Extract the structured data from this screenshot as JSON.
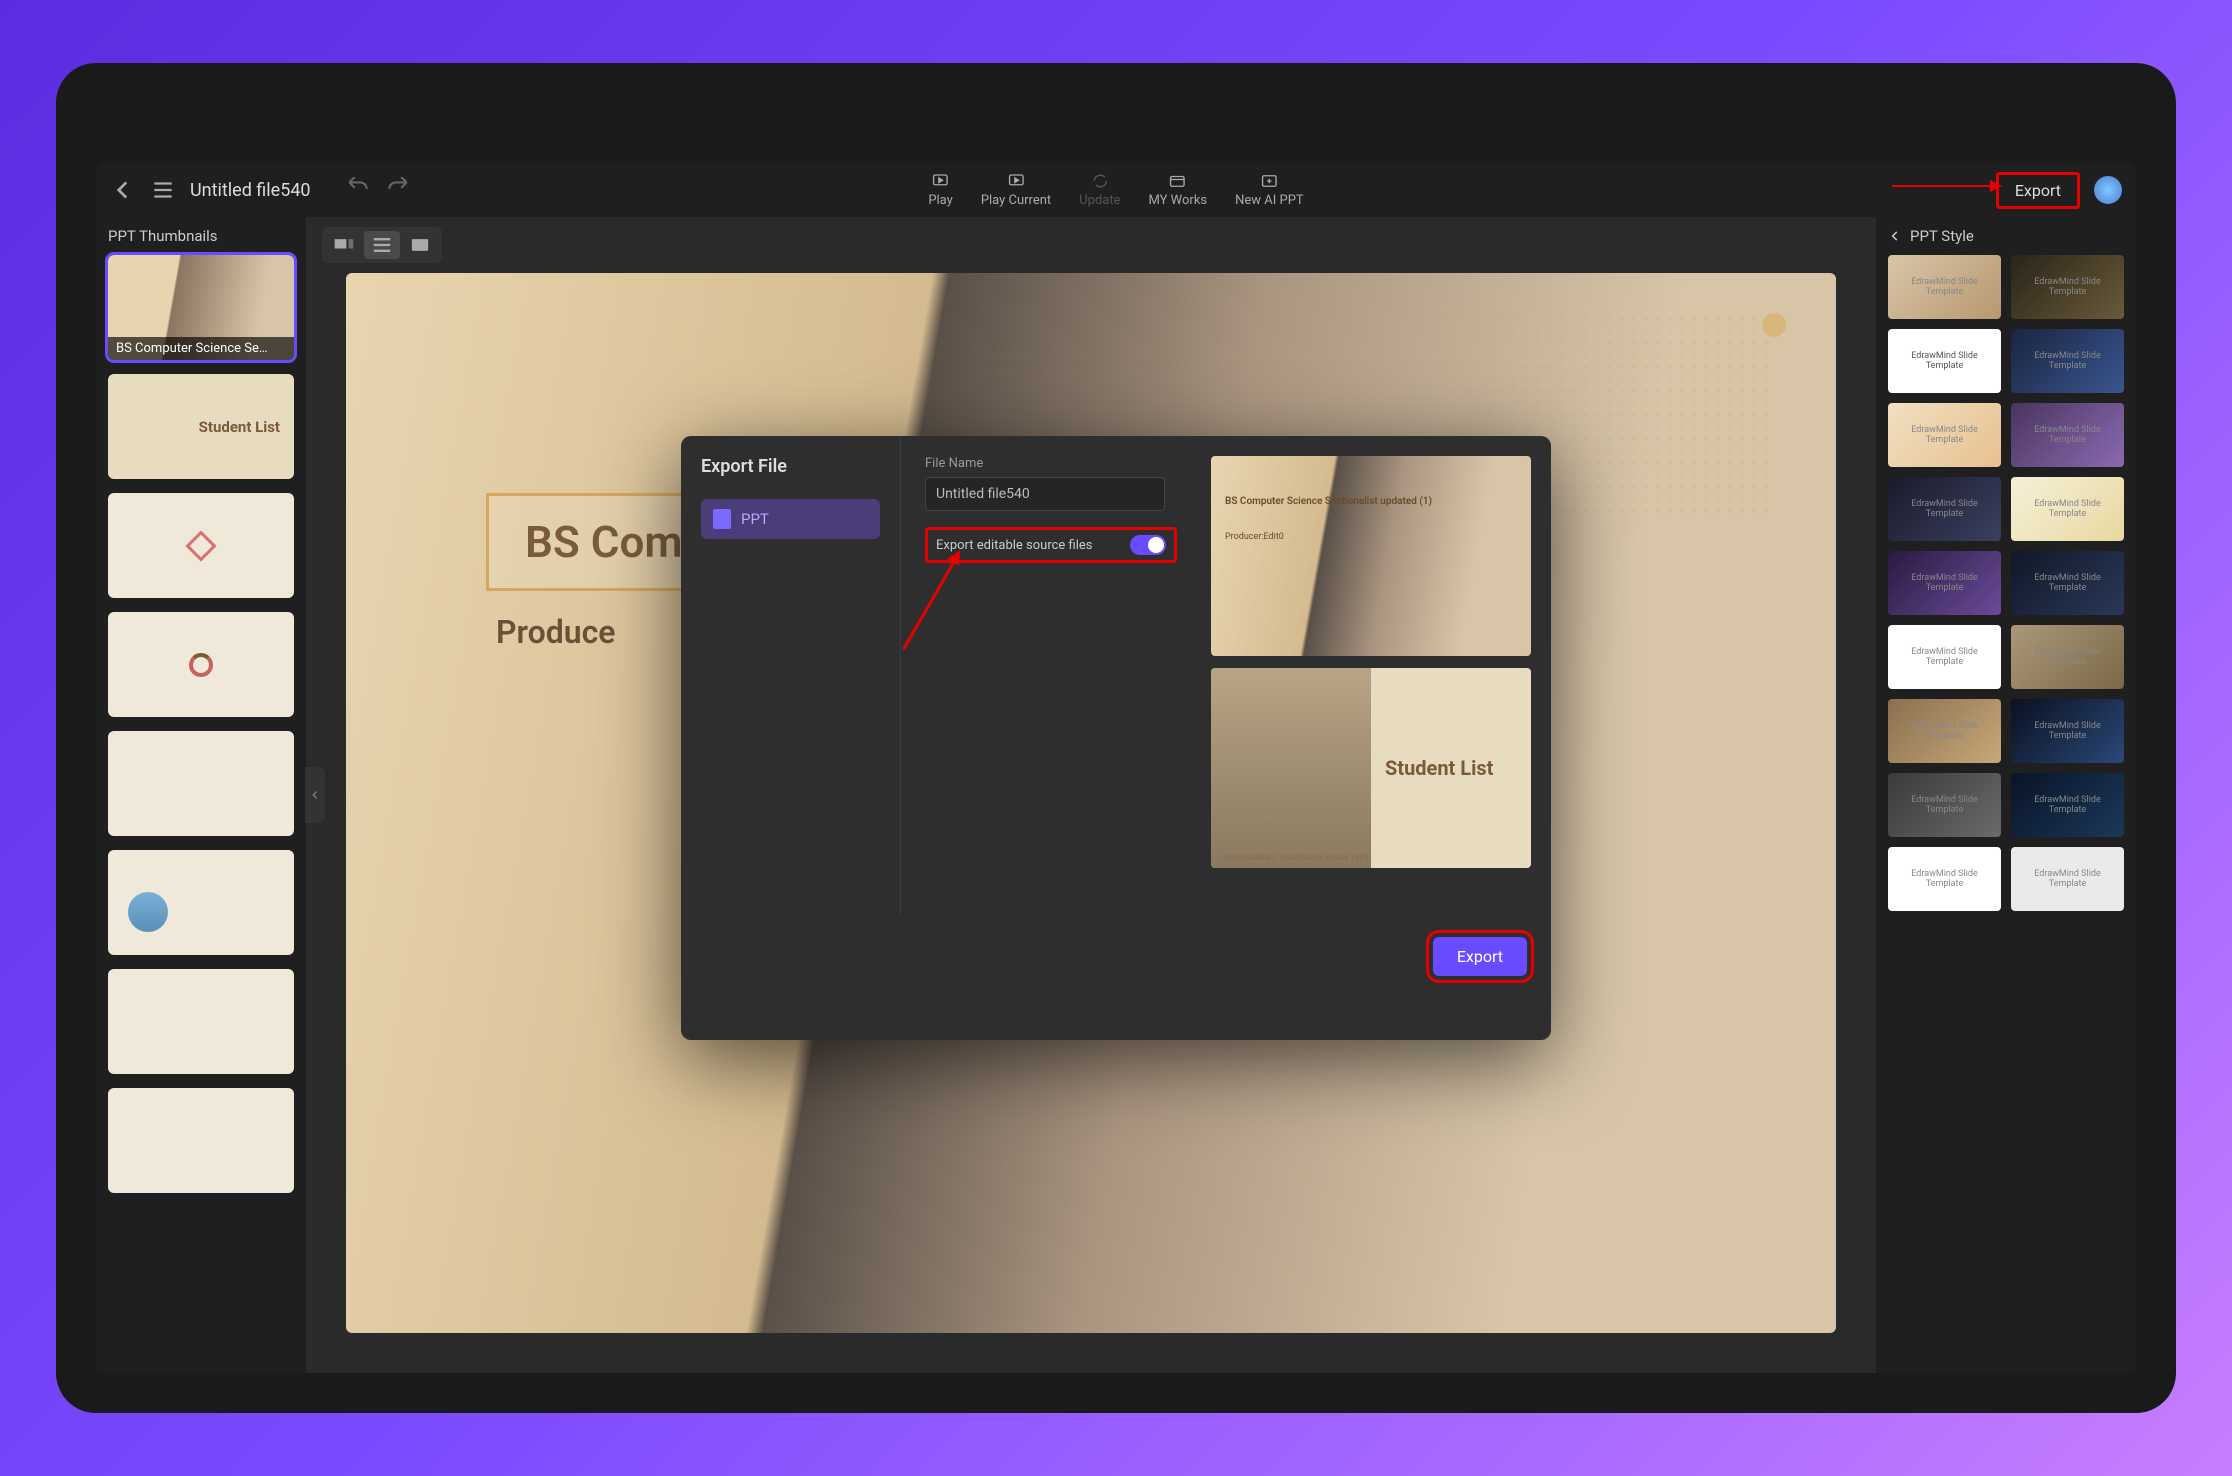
{
  "toolbar": {
    "doc_title": "Untitled file540",
    "play": "Play",
    "play_current": "Play Current",
    "update": "Update",
    "my_works": "MY Works",
    "new_ai_ppt": "New AI PPT",
    "export": "Export"
  },
  "left_panel": {
    "title": "PPT Thumbnails",
    "thumbs": [
      {
        "label": "BS Computer Science Se…"
      },
      {
        "label": "Student List"
      },
      {
        "label": ""
      },
      {
        "label": ""
      },
      {
        "label": ""
      },
      {
        "label": ""
      },
      {
        "label": ""
      },
      {
        "label": ""
      }
    ]
  },
  "canvas": {
    "title_partial": "BS Com",
    "subtitle_partial": "Produce"
  },
  "right_panel": {
    "title": "PPT Style",
    "style_label": "EdrawMind Slide Template"
  },
  "dialog": {
    "title": "Export File",
    "format_ppt": "PPT",
    "filename_label": "File Name",
    "filename_value": "Untitled file540",
    "toggle_label": "Export editable source files",
    "preview1_title": "BS Computer Science Sectionalist updated (1)",
    "preview1_sub": "Producer:Edit0",
    "preview2_title": "Student List",
    "preview2_caption": "MUHAMMAD HASSNAIN KHAN (SP)",
    "export_button": "Export"
  }
}
